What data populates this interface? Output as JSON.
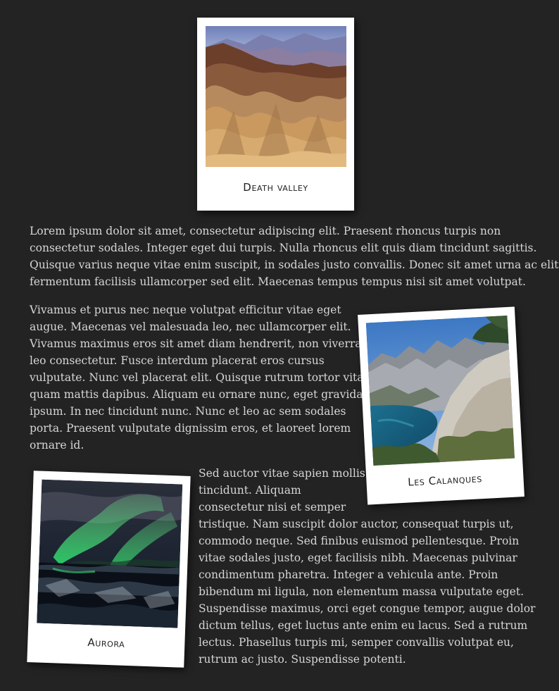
{
  "photos": {
    "death_valley": {
      "caption": "Death valley"
    },
    "les_calanques": {
      "caption": "Les Calanques"
    },
    "aurora": {
      "caption": "Aurora"
    }
  },
  "article": {
    "paragraph_1": [
      "Lorem ipsum dolor sit amet, consectetur adipiscing elit. Praesent rhoncus turpis non",
      "consectetur sodales. Integer eget dui turpis. Nulla rhoncus elit quis diam tincidunt sagittis.",
      "Quisque varius neque vitae enim suscipit, in sodales justo convallis. Donec sit amet urna ac elit",
      "fermentum facilisis ullamcorper sed elit. Maecenas tempus tempus nisi sit amet volutpat."
    ],
    "paragraph_2": [
      "Vivamus et purus nec neque volutpat efficitur vitae eget",
      "augue. Maecenas vel malesuada leo, nec ullamcorper elit.",
      "Vivamus maximus eros sit amet diam hendrerit, non viverra",
      "leo consectetur. Fusce interdum placerat eros cursus",
      "vulputate. Nunc vel placerat elit. Quisque rutrum tortor vitae",
      "quam mattis dapibus. Aliquam eu ornare nunc, eget gravida",
      "ipsum. In nec tincidunt nunc. Nunc et leo ac sem sodales",
      "porta. Praesent vulputate dignissim eros, et laoreet lorem",
      "ornare id."
    ],
    "paragraph_3": [
      "Sed auctor vitae sapien mollis",
      "tincidunt. Aliquam",
      "consectetur nisi et semper",
      "tristique. Nam suscipit dolor auctor, consequat turpis ut,",
      "commodo neque. Sed finibus euismod pellentesque. Proin",
      "vitae sodales justo, eget facilisis nibh. Maecenas pulvinar",
      "condimentum pharetra. Integer a vehicula ante. Proin",
      "bibendum mi ligula, non elementum massa vulputate eget.",
      "Suspendisse maximus, orci eget congue tempor, augue dolor",
      "dictum tellus, eget luctus ante enim eu lacus. Sed a rutrum",
      "lectus. Phasellus turpis mi, semper convallis volutpat eu,",
      "rutrum ac justo. Suspendisse potenti."
    ]
  }
}
